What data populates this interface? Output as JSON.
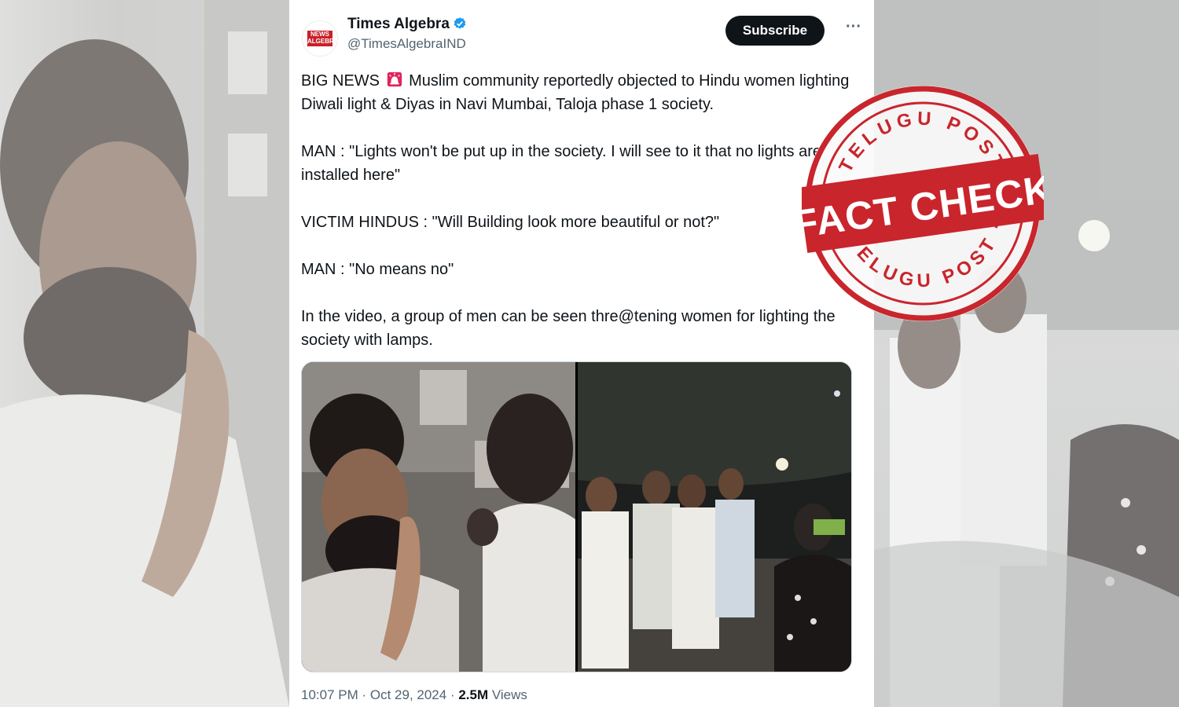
{
  "tweet": {
    "author_name": "Times Algebra",
    "handle": "@TimesAlgebraIND",
    "logo_text": "NEWS ALGEBRA",
    "subscribe_label": "Subscribe",
    "more_label": "···",
    "paragraphs": [
      {
        "before": "BIG NEWS ",
        "icon": "siren-icon",
        "after": " Muslim community reportedly objected to Hindu women lighting Diwali light & Diyas in Navi Mumbai, Taloja phase 1 society."
      },
      {
        "text": "MAN : \"Lights won't be put up in the society. I will see to it that no lights are installed here\""
      },
      {
        "text": "VICTIM HINDUS : \"Will Building look more beautiful or not?\""
      },
      {
        "text": "MAN : \"No means no\""
      },
      {
        "text": "In the video, a group of men can be seen thre@tening women for lighting the society with lamps."
      }
    ],
    "timestamp": "10:07 PM · Oct 29, 2024 · ",
    "views_count": "2.5M",
    "views_label": " Views",
    "verified_icon": "verified-badge-icon",
    "brand_color": "#c8202a"
  },
  "stamp": {
    "top_text": "TELUGU POST",
    "center_text": "FACT CHECK",
    "bottom_text": "TELUGU POST",
    "color": "#c9252c"
  }
}
